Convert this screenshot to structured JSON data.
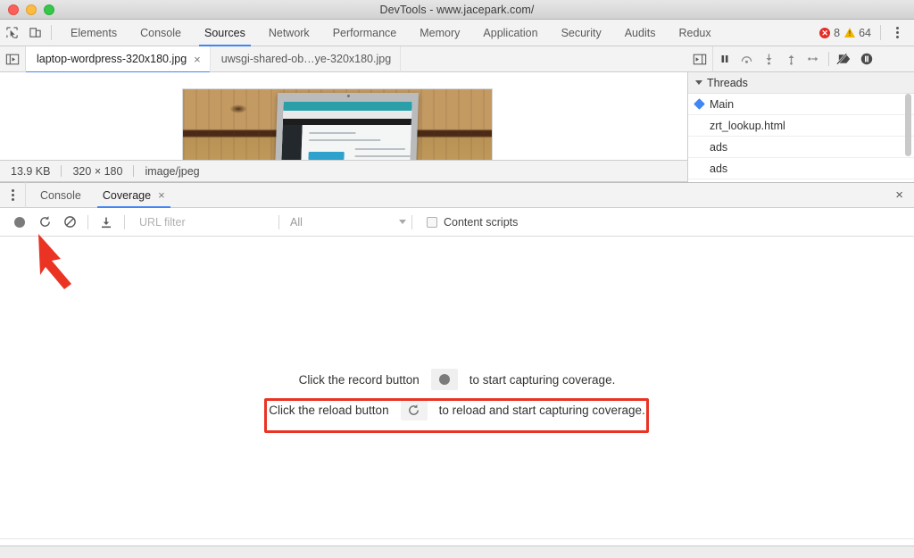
{
  "window": {
    "title": "DevTools - www.jacepark.com/",
    "traffic_lights": [
      "close",
      "minimize",
      "zoom"
    ]
  },
  "toolbar": {
    "inspect_icon": "inspect-element-icon",
    "device_icon": "device-toolbar-icon",
    "panels": [
      {
        "label": "Elements",
        "active": false
      },
      {
        "label": "Console",
        "active": false
      },
      {
        "label": "Sources",
        "active": true
      },
      {
        "label": "Network",
        "active": false
      },
      {
        "label": "Performance",
        "active": false
      },
      {
        "label": "Memory",
        "active": false
      },
      {
        "label": "Application",
        "active": false
      },
      {
        "label": "Security",
        "active": false
      },
      {
        "label": "Audits",
        "active": false
      },
      {
        "label": "Redux",
        "active": false
      }
    ],
    "error_count": "8",
    "warning_count": "64",
    "error_color": "#e52d27",
    "warning_color": "#f2b600",
    "more_icon": "kebab-menu-icon"
  },
  "sources": {
    "navigator_toggle_icon": "show-navigator-icon",
    "file_tabs": [
      {
        "label": "laptop-wordpress-320x180.jpg",
        "active": true,
        "close": "×"
      },
      {
        "label": "uwsgi-shared-ob…ye-320x180.jpg",
        "active": false
      }
    ],
    "image_status": {
      "size": "13.9 KB",
      "dimensions": "320 × 180",
      "mime": "image/jpeg"
    }
  },
  "debugger": {
    "buttons": [
      {
        "name": "pause-script-execution",
        "glyph": "pause-icon"
      },
      {
        "name": "step-over-next-call",
        "glyph": "step-over-icon"
      },
      {
        "name": "step-into-next-call",
        "glyph": "step-into-icon"
      },
      {
        "name": "step-out-of-current-function",
        "glyph": "step-out-icon"
      },
      {
        "name": "step",
        "glyph": "step-icon"
      },
      {
        "name": "deactivate-breakpoints",
        "glyph": "deactivate-breakpoints-icon"
      },
      {
        "name": "pause-on-exceptions",
        "glyph": "pause-on-exceptions-icon"
      }
    ]
  },
  "threads": {
    "header": "Threads",
    "items": [
      {
        "label": "Main",
        "selected": true
      },
      {
        "label": "zrt_lookup.html",
        "selected": false
      },
      {
        "label": "ads",
        "selected": false
      },
      {
        "label": "ads",
        "selected": false
      }
    ]
  },
  "drawer": {
    "more_icon": "kebab-menu-icon",
    "tabs": [
      {
        "label": "Console",
        "active": false
      },
      {
        "label": "Coverage",
        "active": true,
        "close": "×"
      }
    ],
    "close_label": "×"
  },
  "coverage": {
    "toolbar": {
      "record_icon": "record-icon",
      "reload_icon": "reload-icon",
      "clear_icon": "clear-icon",
      "export_icon": "export-download-icon",
      "url_filter_value": "",
      "url_filter_placeholder": "URL filter",
      "type_filter_value": "All",
      "content_scripts_label": "Content scripts",
      "content_scripts_checked": false
    },
    "empty_state": {
      "line1_prefix": "Click the record button",
      "line1_suffix": "to start capturing coverage.",
      "line1_icon": "record-icon",
      "line2_prefix": "Click the reload button",
      "line2_suffix": "to reload and start capturing coverage.",
      "line2_icon": "reload-icon"
    }
  },
  "annotations": {
    "arrow_color": "#ea3323",
    "highlight_box_color": "#ea3323",
    "arrow_target": "reload-button",
    "highlight_target": "reload-instruction-line"
  }
}
